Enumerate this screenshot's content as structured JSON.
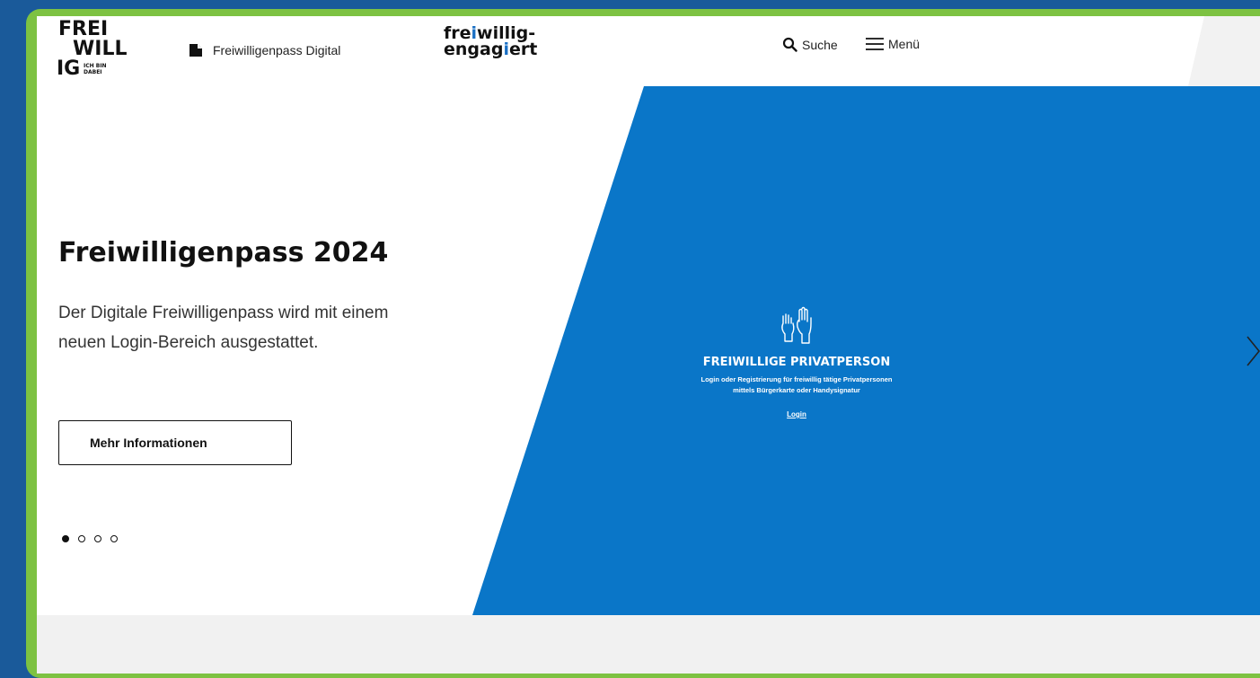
{
  "header": {
    "logo": {
      "line1": "FREI",
      "line2": "WILL",
      "line3": "IG",
      "tagline_1": "ICH BIN",
      "tagline_2": "DABEI"
    },
    "pass_link_label": "Freiwilligenpass Digital",
    "engagiert_logo": {
      "line1_a": "fre",
      "line1_b": "i",
      "line1_c": "willig-",
      "line2_a": "engag",
      "line2_b": "i",
      "line2_c": "ert"
    },
    "search_label": "Suche",
    "menu_label": "Menü"
  },
  "hero": {
    "title": "Freiwilligenpass 2024",
    "text": "Der Digitale Freiwilligenpass wird mit einem neuen Login-Bereich ausgestattet.",
    "button_label": "Mehr Informationen",
    "slides_total": 4,
    "active_slide": 1
  },
  "panel": {
    "title": "FREIWILLIGE PRIVATPERSON",
    "desc_line1": "Login oder Registrierung für freiwillig tätige Privatpersonen",
    "desc_line2": "mittels Bürgerkarte oder Handysignatur",
    "login_label": "Login"
  },
  "icons": [
    "document-icon",
    "search-icon",
    "hamburger-menu-icon",
    "raised-hands-icon",
    "chevron-right-icon"
  ],
  "colors": {
    "background": "#1a5a9a",
    "frame": "#7dc242",
    "panel_blue": "#0a76c8",
    "text": "#111111"
  }
}
